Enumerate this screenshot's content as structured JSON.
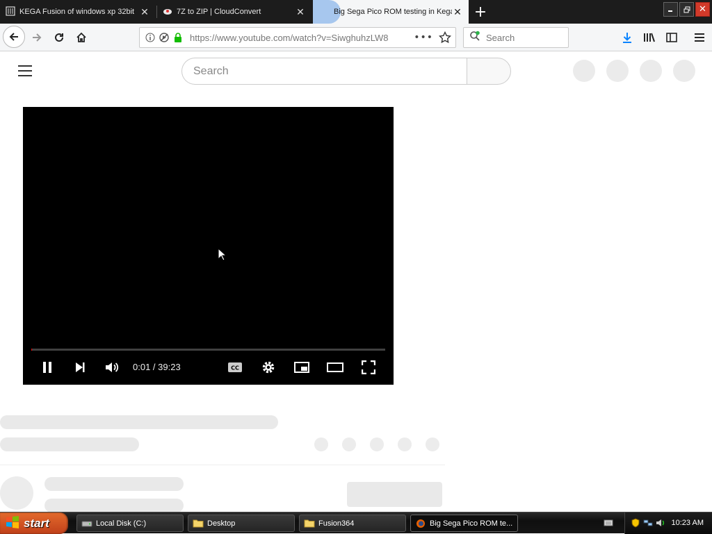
{
  "browser": {
    "tabs": [
      {
        "title": "KEGA Fusion of windows xp 32bit"
      },
      {
        "title": "7Z to ZIP | CloudConvert"
      },
      {
        "title": "Big Sega Pico ROM testing in Kega"
      }
    ],
    "url": "https://www.youtube.com/watch?v=SiwghuhzLW8",
    "search_placeholder": "Search"
  },
  "youtube": {
    "search_placeholder": "Search"
  },
  "player": {
    "time": "0:01 / 39:23",
    "progress_fraction": 0.0004
  },
  "taskbar": {
    "start_label": "start",
    "tasks": [
      {
        "label": "Local Disk (C:)",
        "icon": "drive-icon"
      },
      {
        "label": "Desktop",
        "icon": "folder-icon"
      },
      {
        "label": "Fusion364",
        "icon": "folder-icon"
      },
      {
        "label": "Big Sega Pico ROM te...",
        "icon": "firefox-icon"
      }
    ],
    "clock": "10:23 AM"
  },
  "colors": {
    "accent": "#ff0000",
    "tab_active_bg": "#f5f6f7",
    "start_button": "#d9561f"
  }
}
